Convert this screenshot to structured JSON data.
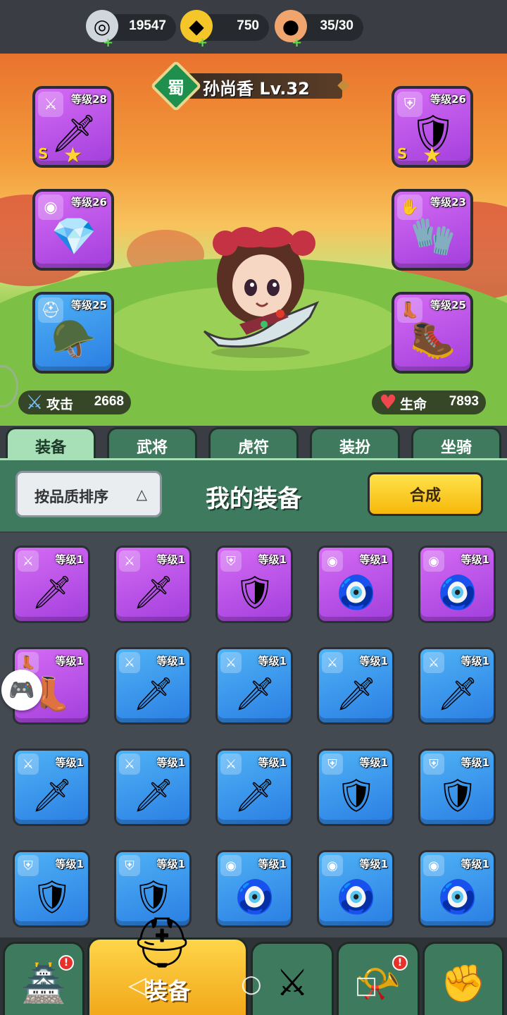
{
  "currency": {
    "silver": "19547",
    "gold": "750",
    "stamina": "35/30"
  },
  "hero": {
    "kingdom": "蜀",
    "name": "孙尚香 Lv.32",
    "attack_label": "攻击",
    "attack_value": "2668",
    "hp_label": "生命",
    "hp_value": "7893"
  },
  "equipped": {
    "weapon": {
      "level": "等级28",
      "grade": "S"
    },
    "armor": {
      "level": "等级26",
      "grade": "S"
    },
    "necklace": {
      "level": "等级26"
    },
    "gauntlet": {
      "level": "等级23"
    },
    "helmet": {
      "level": "等级25"
    },
    "boots": {
      "level": "等级25"
    }
  },
  "tabs": [
    "装备",
    "武将",
    "虎符",
    "装扮",
    "坐骑"
  ],
  "panel": {
    "sort_label": "按品质排序",
    "title": "我的装备",
    "merge_label": "合成"
  },
  "inventory": [
    {
      "level": "等级1",
      "rarity": "purple",
      "type": "weapon",
      "icon": "✦"
    },
    {
      "level": "等级1",
      "rarity": "purple",
      "type": "weapon",
      "icon": "✦"
    },
    {
      "level": "等级1",
      "rarity": "purple",
      "type": "armor",
      "icon": "✦"
    },
    {
      "level": "等级1",
      "rarity": "purple",
      "type": "necklace",
      "icon": "✦"
    },
    {
      "level": "等级1",
      "rarity": "purple",
      "type": "necklace",
      "icon": "✦"
    },
    {
      "level": "等级1",
      "rarity": "purple",
      "type": "boots",
      "icon": "✦"
    },
    {
      "level": "等级1",
      "rarity": "blue",
      "type": "weapon",
      "icon": "✦"
    },
    {
      "level": "等级1",
      "rarity": "blue",
      "type": "weapon",
      "icon": "✦"
    },
    {
      "level": "等级1",
      "rarity": "blue",
      "type": "weapon",
      "icon": "✦"
    },
    {
      "level": "等级1",
      "rarity": "blue",
      "type": "weapon",
      "icon": "✦"
    },
    {
      "level": "等级1",
      "rarity": "blue",
      "type": "weapon",
      "icon": "✦"
    },
    {
      "level": "等级1",
      "rarity": "blue",
      "type": "weapon",
      "icon": "✦"
    },
    {
      "level": "等级1",
      "rarity": "blue",
      "type": "weapon",
      "icon": "✦"
    },
    {
      "level": "等级1",
      "rarity": "blue",
      "type": "armor",
      "icon": "✦"
    },
    {
      "level": "等级1",
      "rarity": "blue",
      "type": "armor",
      "icon": "✦"
    },
    {
      "level": "等级1",
      "rarity": "blue",
      "type": "armor",
      "icon": "✦"
    },
    {
      "level": "等级1",
      "rarity": "blue",
      "type": "armor",
      "icon": "✦"
    },
    {
      "level": "等级1",
      "rarity": "blue",
      "type": "necklace",
      "icon": "✦"
    },
    {
      "level": "等级1",
      "rarity": "blue",
      "type": "necklace",
      "icon": "✦"
    },
    {
      "level": "等级1",
      "rarity": "blue",
      "type": "necklace",
      "icon": "✦"
    }
  ],
  "bottom_nav": {
    "active_label": "装备"
  },
  "colors": {
    "purple_rarity": "#b44fe6",
    "blue_rarity": "#3a93ec",
    "panel_green": "#3d7a5e",
    "merge_yellow": "#f6c417"
  }
}
